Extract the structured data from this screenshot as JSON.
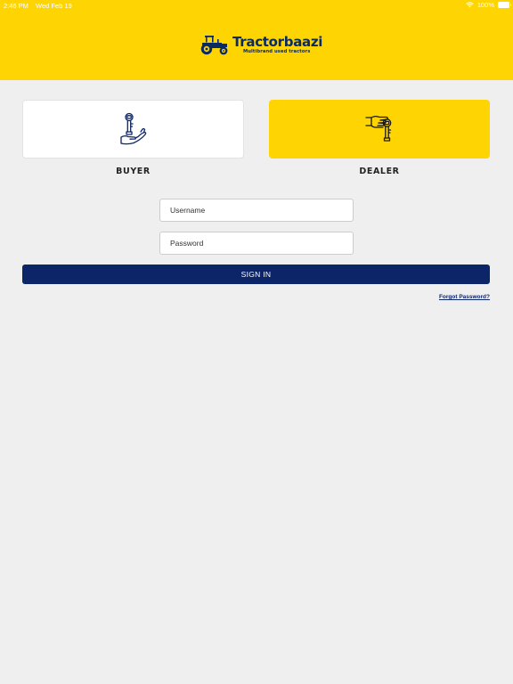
{
  "status_bar": {
    "time": "2:46 PM",
    "date": "Wed Feb 19",
    "battery": "100%",
    "icons": [
      "wifi-icon",
      "battery-icon"
    ]
  },
  "header": {
    "brand_name": "Tractorbaazi",
    "tagline": "Multibrand used tractors",
    "background": "#fed402",
    "brand_color": "#0a2a63"
  },
  "roles": {
    "buyer": {
      "label": "BUYER",
      "icon": "hand-key-icon",
      "selected": false
    },
    "dealer": {
      "label": "DEALER",
      "icon": "hand-giving-key-icon",
      "selected": true
    }
  },
  "login": {
    "username_placeholder": "Username",
    "password_placeholder": "Password",
    "signin_label": "SIGN IN",
    "signin_color": "#0c2468",
    "forgot_label": "Forgot Password?"
  }
}
